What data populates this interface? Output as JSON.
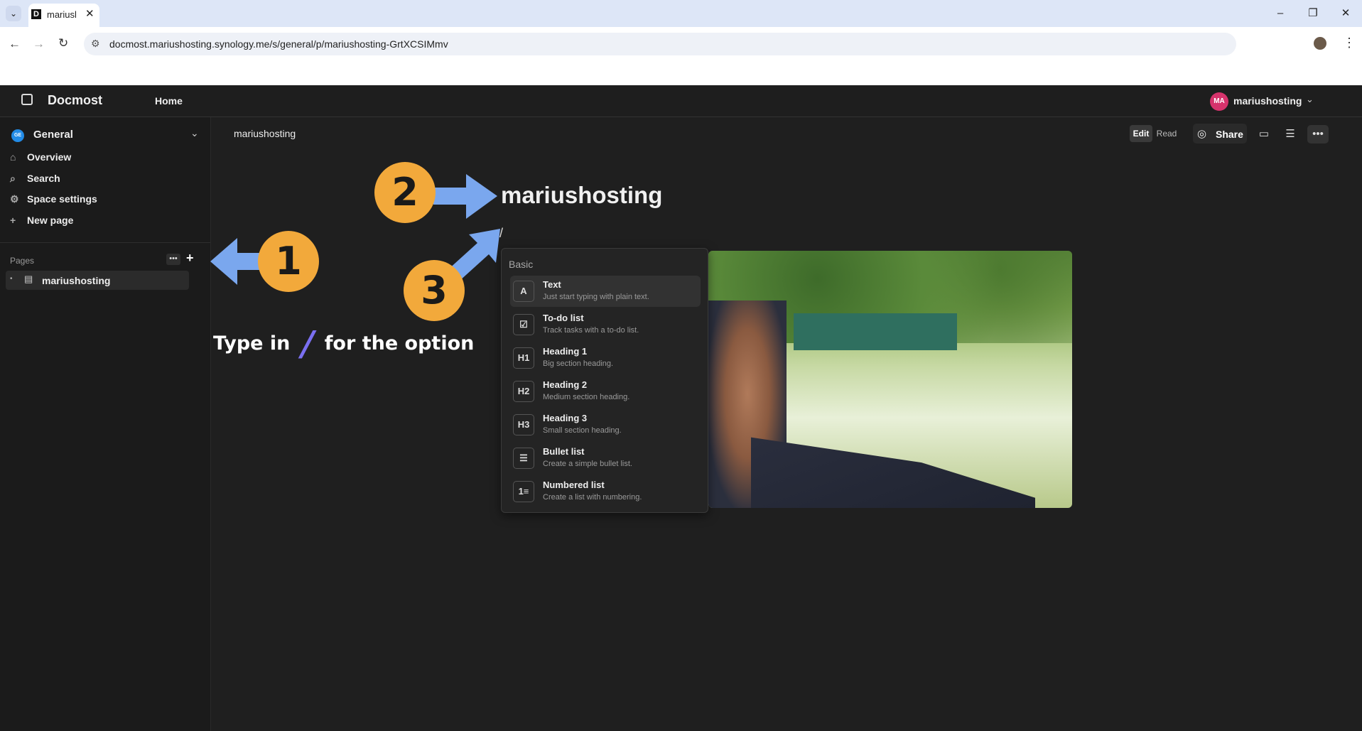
{
  "browser": {
    "tab_title": "mariusl",
    "tab_favicon": "D",
    "url": "docmost.mariushosting.synology.me/s/general/p/mariushosting-GrtXCSIMmv"
  },
  "header": {
    "brand": "Docmost",
    "home_label": "Home",
    "user_initials": "MA",
    "user_name": "mariushosting"
  },
  "sidebar": {
    "space_initials": "GE",
    "space_name": "General",
    "nav": [
      "Overview",
      "Search",
      "Space settings",
      "New page"
    ],
    "pages_label": "Pages",
    "pages": [
      "mariushosting"
    ]
  },
  "toolbar": {
    "breadcrumb": "mariushosting",
    "edit_label": "Edit",
    "read_label": "Read",
    "share_label": "Share"
  },
  "editor": {
    "title": "mariushosting",
    "slash_text": "/"
  },
  "slash_menu": {
    "section": "Basic",
    "items": [
      {
        "icon": "A",
        "title": "Text",
        "desc": "Just start typing with plain text."
      },
      {
        "icon": "☑",
        "title": "To-do list",
        "desc": "Track tasks with a to-do list."
      },
      {
        "icon": "H1",
        "title": "Heading 1",
        "desc": "Big section heading."
      },
      {
        "icon": "H2",
        "title": "Heading 2",
        "desc": "Medium section heading."
      },
      {
        "icon": "H3",
        "title": "Heading 3",
        "desc": "Small section heading."
      },
      {
        "icon": "☰",
        "title": "Bullet list",
        "desc": "Create a simple bullet list."
      },
      {
        "icon": "1≡",
        "title": "Numbered list",
        "desc": "Create a list with numbering."
      }
    ]
  },
  "annotations": {
    "badges": [
      "1",
      "2",
      "3"
    ],
    "caption_before": "Type in",
    "caption_slash": "/",
    "caption_after": "for the option",
    "badge_color": "#f2a93b",
    "arrow_color": "#7aa7ee"
  },
  "colors": {
    "avatar": "#d6336c",
    "space_badge": "#228be6"
  }
}
